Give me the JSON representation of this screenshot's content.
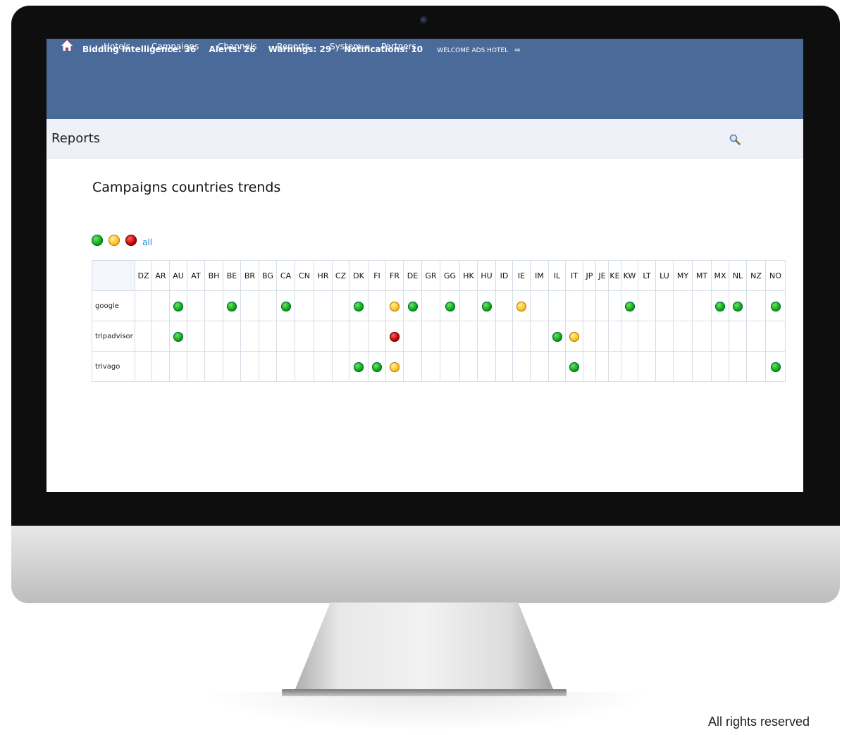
{
  "header": {
    "stats": [
      {
        "label": "Bidding Intelligence: 36"
      },
      {
        "label": "Alerts: 26"
      },
      {
        "label": "Warnings: 29"
      },
      {
        "label": "Notifications: 10"
      }
    ],
    "welcome": "WELCOME ADS HOTEL"
  },
  "nav": {
    "items": [
      "Hotels",
      "Campaigns",
      "Channels",
      "Reports",
      "System",
      "Partners"
    ]
  },
  "page": {
    "title": "Reports",
    "heading": "Campaigns countries trends"
  },
  "filters": {
    "all_label": "all",
    "colors": {
      "green": "#0aa80a",
      "yellow": "#ffc020",
      "red": "#c00000"
    }
  },
  "table": {
    "countries": [
      "DZ",
      "AR",
      "AU",
      "AT",
      "BH",
      "BE",
      "BR",
      "BG",
      "CA",
      "CN",
      "HR",
      "CZ",
      "DK",
      "FI",
      "FR",
      "DE",
      "GR",
      "GG",
      "HK",
      "HU",
      "ID",
      "IE",
      "IM",
      "IL",
      "IT",
      "JP",
      "JE",
      "KE",
      "KW",
      "LT",
      "LU",
      "MY",
      "MT",
      "MX",
      "NL",
      "NZ",
      "NO"
    ],
    "rows": [
      {
        "name": "google",
        "cells": {
          "AU": "green",
          "BE": "green",
          "CA": "green",
          "DK": "green",
          "FR": "yellow",
          "DE": "green",
          "GG": "green",
          "HU": "green",
          "IE": "yellow",
          "KW": "green",
          "MX": "green",
          "NL": "green",
          "NO": "green"
        }
      },
      {
        "name": "tripadvisor",
        "cells": {
          "AU": "green",
          "FR": "red",
          "IL": "green",
          "IT": "yellow"
        }
      },
      {
        "name": "trivago",
        "cells": {
          "DK": "green",
          "FI": "green",
          "FR": "yellow",
          "IT": "green",
          "NO": "green"
        }
      }
    ]
  },
  "footer": {
    "copyright": "All rights reserved"
  }
}
